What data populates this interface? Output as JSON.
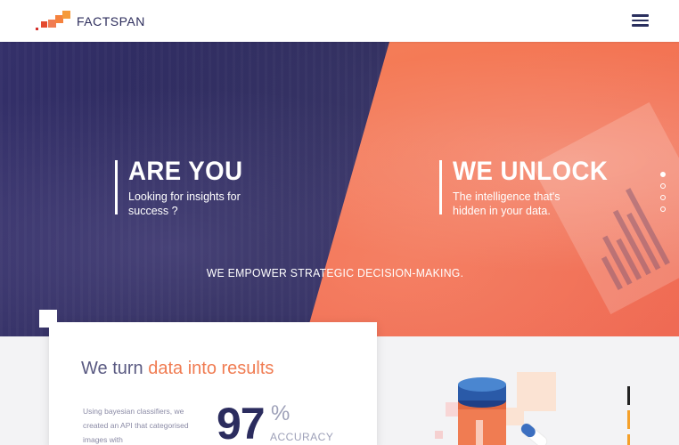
{
  "header": {
    "brand": "FACTSPAN",
    "menu_icon": "hamburger-menu-icon",
    "logo_colors": [
      "#d4312c",
      "#f07c52",
      "#f59a3a"
    ]
  },
  "hero": {
    "left": {
      "title": "ARE YOU",
      "subtitle": "Looking for insights for success ?"
    },
    "right": {
      "title": "WE UNLOCK",
      "subtitle": "The intelligence that's hidden in your data."
    },
    "tagline": "WE EMPOWER STRATEGIC DECISION-MAKING.",
    "slides": {
      "count": 4,
      "active": 1
    },
    "colors": {
      "navy": "#2c2a5e",
      "coral": "#f27052"
    }
  },
  "results": {
    "title_prefix": "We turn ",
    "title_highlight": "data into results",
    "description": "Using bayesian classifiers, we created an API that categorised images with",
    "value": "97",
    "unit": "%",
    "unit_label": "ACCURACY",
    "accent_color": "#f07c52"
  }
}
